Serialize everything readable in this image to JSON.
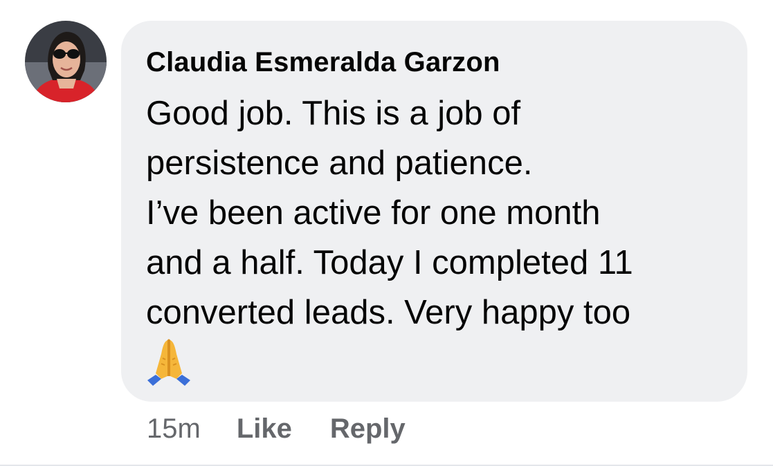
{
  "comment": {
    "author": "Claudia Esmeralda Garzon",
    "body_lines": [
      "Good job. This is a job of",
      "persistence and patience.",
      "I’ve been active for one month",
      "and a half. Today I completed 11",
      "converted leads. Very happy too"
    ],
    "emoji": "folded-hands"
  },
  "actions": {
    "timestamp": "15m",
    "like_label": "Like",
    "reply_label": "Reply"
  },
  "colors": {
    "bubble_background": "#eff0f2",
    "primary_text": "#050505",
    "secondary_text": "#65676b"
  }
}
